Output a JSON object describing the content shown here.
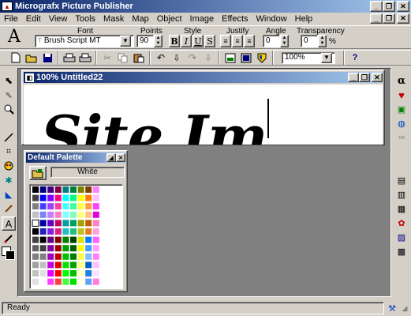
{
  "app": {
    "title": "Micrografx Picture Publisher"
  },
  "menu": [
    "File",
    "Edit",
    "View",
    "Tools",
    "Mask",
    "Map",
    "Object",
    "Image",
    "Effects",
    "Window",
    "Help"
  ],
  "textbar": {
    "font_label": "Font",
    "font_value": "Brush Script MT",
    "points_label": "Points",
    "points_value": "90",
    "style_label": "Style",
    "style_buttons": [
      "B",
      "I",
      "U",
      "S"
    ],
    "justify_label": "Justify",
    "angle_label": "Angle",
    "angle_value": "0",
    "transparency_label": "Transparency",
    "transparency_value": "0",
    "transparency_unit": "%"
  },
  "toolbar": {
    "zoom_value": "100%"
  },
  "doc": {
    "title": "100% Untitled22",
    "canvas_text": "Site Ima"
  },
  "palette": {
    "title": "Default Palette",
    "selected_color_name": "White"
  },
  "status": {
    "text": "Ready"
  },
  "colors": {
    "titlebar": "#0a246a",
    "workspace": "#808080",
    "palette_columns": [
      [
        "#000000",
        "#404040",
        "#808080",
        "#c0c0c0",
        "#ffffff",
        "#000000",
        "#404040",
        "#606060",
        "#808080",
        "#a0a0a0",
        "#c0c0c0",
        "#e0e0e0"
      ],
      [
        "#000080",
        "#0000ff",
        "#4040ff",
        "#8080ff",
        "#0000a0",
        "#2020c0",
        "#000000",
        "#404040",
        "#808080",
        "#c0c0c0",
        "#e0e0e0",
        "#ffffff"
      ],
      [
        "#400080",
        "#8000ff",
        "#a040ff",
        "#c080ff",
        "#6000c0",
        "#8020e0",
        "#600080",
        "#8000a0",
        "#a000c0",
        "#c000e0",
        "#e000ff",
        "#ff40ff"
      ],
      [
        "#800040",
        "#ff0080",
        "#ff40a0",
        "#ff80c0",
        "#c00060",
        "#e02080",
        "#800000",
        "#a00000",
        "#c00000",
        "#e00000",
        "#ff0000",
        "#ff4040"
      ],
      [
        "#008080",
        "#00ffff",
        "#40ffff",
        "#80ffff",
        "#00a0a0",
        "#20c0c0",
        "#008000",
        "#00a000",
        "#00c000",
        "#00e000",
        "#00ff00",
        "#40ff40"
      ],
      [
        "#008040",
        "#00ff80",
        "#40ffa0",
        "#80ffc0",
        "#00a060",
        "#20c080",
        "#004000",
        "#006000",
        "#008000",
        "#00a000",
        "#00c000",
        "#00e000"
      ],
      [
        "#808000",
        "#ffff00",
        "#ffff40",
        "#ffff80",
        "#a0a000",
        "#c0c020",
        "#e0e000",
        "#ffff00",
        "#ffff40",
        "#ffff80",
        "#ffffc0",
        "#ffffe0"
      ],
      [
        "#804000",
        "#ff8000",
        "#ffa040",
        "#ffc080",
        "#c06000",
        "#e08020",
        "#0080ff",
        "#40a0ff",
        "#80c0ff",
        "#0060c0",
        "#2080e0",
        "#60a0ff"
      ],
      [
        "#ff80ff",
        "#ffc0ff",
        "#ff40ff",
        "#e000e0",
        "#ff80c0",
        "#ffa0e0",
        "#ff60ff",
        "#ffa0ff",
        "#ff80ff",
        "#ffc0ff",
        "#ffe0ff",
        "#ff80e0"
      ]
    ]
  }
}
